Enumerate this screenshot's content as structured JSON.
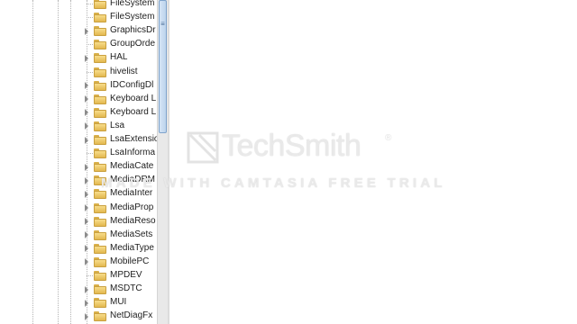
{
  "registry_tree": {
    "items": [
      {
        "label": "FileSystem",
        "expandable": false
      },
      {
        "label": "FileSystem",
        "expandable": false
      },
      {
        "label": "GraphicsDr",
        "expandable": true
      },
      {
        "label": "GroupOrde",
        "expandable": false
      },
      {
        "label": "HAL",
        "expandable": true
      },
      {
        "label": "hivelist",
        "expandable": false
      },
      {
        "label": "IDConfigDl",
        "expandable": true
      },
      {
        "label": "Keyboard L",
        "expandable": true
      },
      {
        "label": "Keyboard L",
        "expandable": true
      },
      {
        "label": "Lsa",
        "expandable": true
      },
      {
        "label": "LsaExtensio",
        "expandable": true
      },
      {
        "label": "LsaInforma",
        "expandable": false
      },
      {
        "label": "MediaCate",
        "expandable": true
      },
      {
        "label": "MediaDRM",
        "expandable": true
      },
      {
        "label": "MediaInter",
        "expandable": true
      },
      {
        "label": "MediaProp",
        "expandable": true
      },
      {
        "label": "MediaReso",
        "expandable": true
      },
      {
        "label": "MediaSets",
        "expandable": true
      },
      {
        "label": "MediaType",
        "expandable": true
      },
      {
        "label": "MobilePC",
        "expandable": true
      },
      {
        "label": "MPDEV",
        "expandable": false
      },
      {
        "label": "MSDTC",
        "expandable": true
      },
      {
        "label": "MUI",
        "expandable": true
      },
      {
        "label": "NetDiagFx",
        "expandable": true
      }
    ]
  },
  "scrollbar": {
    "grip_glyph": "≡"
  },
  "watermark": {
    "brand": "TechSmith",
    "registered": "®",
    "tagline": "MADE WITH CAMTASIA FREE TRIAL"
  },
  "colors": {
    "folder": "#e3b84f",
    "scroll_thumb": "#bcd3ec",
    "text": "#1e1e1e"
  }
}
